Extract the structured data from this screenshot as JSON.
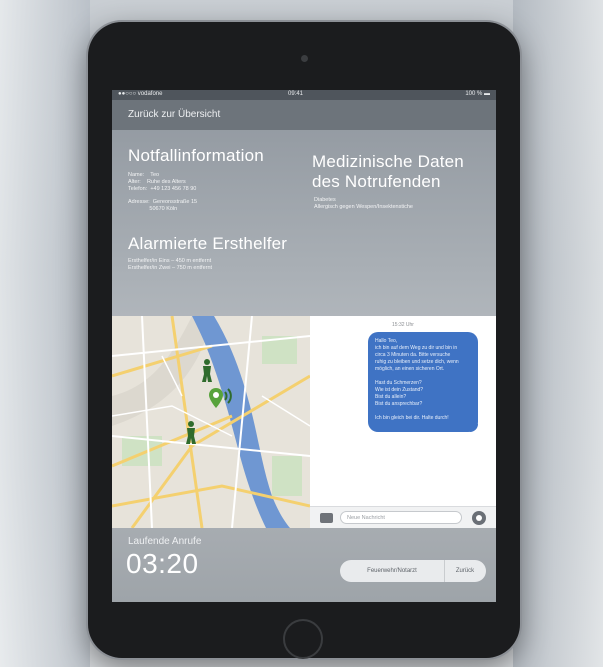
{
  "status_bar": {
    "carrier": "●●○○○ vodafone",
    "time": "09:41",
    "battery": "100 % ▬"
  },
  "nav": {
    "back_label": "Zurück zur Übersicht"
  },
  "emergency_info": {
    "title": "Notfallinformation",
    "details": "Name:    Teo\nAlter:    Ruhe des Alters\nTelefon:  +49 123 456 78 90",
    "address": "Adresse:  Gereonsstraße 15\n              50670 Köln"
  },
  "medical": {
    "title_line1": "Medizinische Daten",
    "title_line2": "des Notrufenden",
    "details": "Diabetes\nAllergisch gegen Wespen/Insektenstiche"
  },
  "alarmed_helpers": {
    "title": "Alarmierte Ersthelfer",
    "details": "Ersthelfer/in Eins – 450 m entfernt\nErsthelfer/in Zwei – 750 m entfernt"
  },
  "chat": {
    "timestamp": "15:32 Uhr",
    "bubble_text": "Hallo Teo,\nich bin auf dem Weg zu dir und bin in\ncirca 3 Minuten da. Bitte versuche\nruhig zu bleiben und setze dich, wenn\nmöglich, an einen sicheren Ort.\n\nHast du Schmerzen?\nWie ist dein Zustand?\nBist du allein?\nBist du ansprechbar?\n\nIch bin gleich bei dir. Halte durch!",
    "input_placeholder": "Neue Nachricht"
  },
  "runtime": {
    "label": "Laufende Anrufe",
    "time": "03:20"
  },
  "actions": {
    "call_label": "Feuerwehr/Notarzt",
    "exit_label": "Zurück"
  },
  "colors": {
    "bubble": "#3f73c4",
    "river": "#6f97d2",
    "map_bg": "#e7e3da",
    "marker_green": "#2f6b2c"
  }
}
